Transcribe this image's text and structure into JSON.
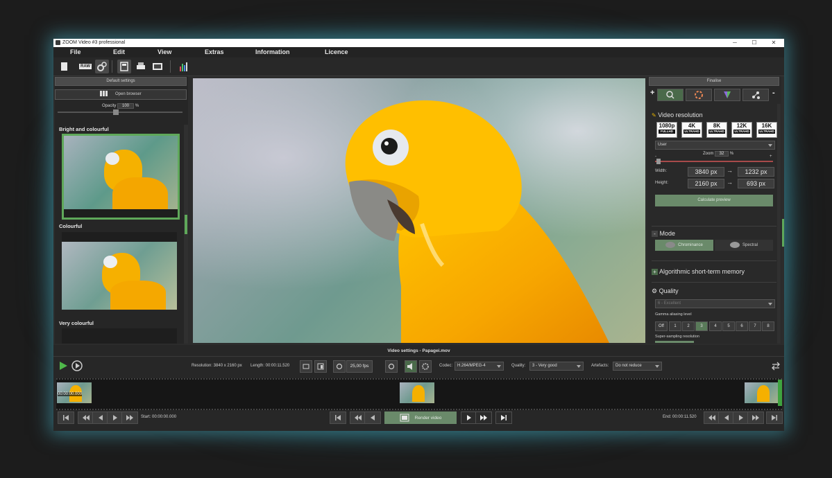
{
  "window": {
    "title": "ZOOM Video #3 professional",
    "minimize": "─",
    "maximize": "☐",
    "close": "✕"
  },
  "menu": [
    {
      "label": "File"
    },
    {
      "label": "Edit"
    },
    {
      "label": "View"
    },
    {
      "label": "Extras"
    },
    {
      "label": "Information"
    },
    {
      "label": "Licence"
    }
  ],
  "toolbar": {
    "raw_label": "RAW"
  },
  "left_panel": {
    "default_settings": "Default settings",
    "open_browser": "Open browser",
    "opacity_label": "Opacity",
    "opacity_value": "100",
    "opacity_unit": "%",
    "categories": [
      {
        "label": "Bright and colourful"
      },
      {
        "label": "Colourful"
      },
      {
        "label": "Very colourful"
      }
    ]
  },
  "right_panel": {
    "finalise": "Finalise",
    "video_resolution_title": "Video resolution",
    "resolutions": [
      {
        "big": "1080p",
        "sub": "FULLHD"
      },
      {
        "big": "4K",
        "sub": "ULTRAHD"
      },
      {
        "big": "8K",
        "sub": "ULTRAHD"
      },
      {
        "big": "12K",
        "sub": "ULTRAHD"
      },
      {
        "big": "16K",
        "sub": "ULTRAHD"
      }
    ],
    "preset_select": "User",
    "zoom_label": "Zoom",
    "zoom_value": "32",
    "zoom_unit": "%",
    "width_label": "Width:",
    "width_from": "3840 px",
    "width_to": "1232 px",
    "height_label": "Height:",
    "height_from": "2160 px",
    "height_to": "693 px",
    "arrow": "→",
    "calculate_preview": "Calculate preview",
    "mode_title": "Mode",
    "mode_chrominance": "Chrominance",
    "mode_spectral": "Spectral",
    "asm_title": "Algorithmic short-term memory",
    "quality_title": "Quality",
    "quality_select": "6 - Excellent",
    "gamma_label": "Gamma aliasing level",
    "gamma_levels": [
      "Off",
      "1",
      "2",
      "3",
      "4",
      "5",
      "6",
      "7",
      "8"
    ],
    "supersampling_label": "Super-sampling resolution",
    "minus": "-",
    "plus": "+"
  },
  "bottom": {
    "video_settings_title": "Video settings - Papagei.mov",
    "resolution": "Resolution: 3840 x 2160 px",
    "length": "Length: 00:00:11.520",
    "fps": "25,00 fps",
    "codec_label": "Codec:",
    "codec_value": "H.264/MPEG-4",
    "quality_label": "Quality:",
    "quality_value": "3 - Very good",
    "artefacts_label": "Artefacts:",
    "artefacts_value": "Do not reduce",
    "timecode": "00:00:00.000",
    "start": "Start: 00:00:00.000",
    "render_video": "Render video",
    "end": "End: 00:00:11.520"
  },
  "colors": {
    "accent_green": "#5fa85a",
    "parrot_yellow": "#f6b300",
    "panel_bg": "#292929"
  }
}
